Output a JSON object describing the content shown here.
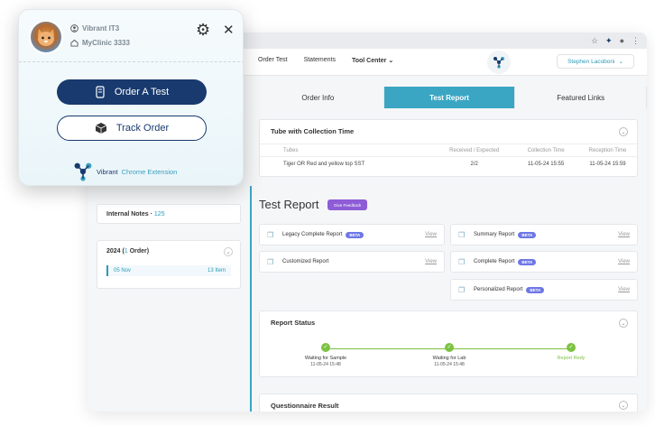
{
  "browser": {
    "nav_links": [
      "Order Test",
      "Statements",
      "Tool Center"
    ],
    "tool_center_caret": "⌄",
    "user_name": "Stephen Lacoboni",
    "user_caret": "⌄"
  },
  "tabs": [
    {
      "label": "Order Info",
      "active": false
    },
    {
      "label": "Test Report",
      "active": true
    },
    {
      "label": "Featured Links",
      "active": false
    }
  ],
  "left": {
    "notes_label": "Internal Notes · ",
    "notes_count": "125",
    "year_label": "2024 (",
    "year_count": "1",
    "year_suffix": " Order)",
    "order_date": "05 Nov",
    "order_items": "13 Item"
  },
  "tube": {
    "title": "Tube with Collection Time",
    "headers": [
      "Tubes",
      "Received / Expected",
      "Collection Time",
      "Reception Time"
    ],
    "row": [
      "Tiger OR Red and yellow top SST",
      "2/2",
      "11-05-24 15:55",
      "11-05-24 15:59"
    ]
  },
  "test_report": {
    "title": "Test Report",
    "feedback_label": "Give Feedback",
    "left_reports": [
      {
        "name": "Legacy Complete Report",
        "beta": true,
        "view": "View"
      },
      {
        "name": "Customized Report",
        "beta": false,
        "view": "View"
      }
    ],
    "right_reports": [
      {
        "name": "Summary Report",
        "beta": true,
        "view": "View"
      },
      {
        "name": "Complete Report",
        "beta": true,
        "view": "View"
      },
      {
        "name": "Personalized Report",
        "beta": true,
        "view": "View"
      }
    ],
    "beta_label": "BETA"
  },
  "status": {
    "title": "Report Status",
    "steps": [
      {
        "label": "Waiting for Sample",
        "time": "11-05-24 15:48"
      },
      {
        "label": "Waiting for Lab",
        "time": "11-05-24 15:48"
      },
      {
        "label": "Report Redy",
        "time": ""
      }
    ]
  },
  "questionnaire": {
    "title": "Questionnaire Result"
  },
  "popup": {
    "user": "Vibrant IT3",
    "clinic": "MyClinic 3333",
    "order_button": "Order A Test",
    "track_button": "Track Order",
    "brand_name": "Vibrant",
    "brand_ext": "Chrome Extension"
  },
  "colors": {
    "accent": "#3aa6c4",
    "navy": "#183a6e",
    "success": "#7cc242",
    "beta": "#6e77e6",
    "feedback": "#8d5cd6"
  }
}
